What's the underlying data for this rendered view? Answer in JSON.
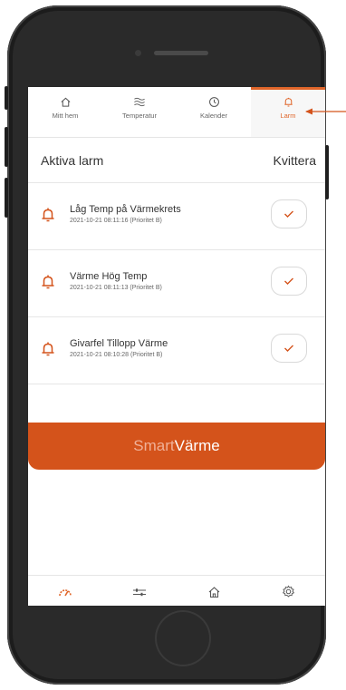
{
  "tabs": [
    {
      "label": "Mitt hem",
      "icon": "home-icon"
    },
    {
      "label": "Temperatur",
      "icon": "heat-waves-icon"
    },
    {
      "label": "Kalender",
      "icon": "clock-icon"
    },
    {
      "label": "Larm",
      "icon": "bell-icon",
      "active": true
    }
  ],
  "alarms_header": {
    "title": "Aktiva larm",
    "acknowledge": "Kvittera"
  },
  "alarms": [
    {
      "name": "Låg Temp på Värmekrets",
      "meta": "2021-10-21 08:11:16 (Prioritet B)"
    },
    {
      "name": "Värme Hög Temp",
      "meta": "2021-10-21 08:11:13 (Prioritet B)"
    },
    {
      "name": "Givarfel Tillopp Värme",
      "meta": "2021-10-21 08:10:28 (Prioritet B)"
    }
  ],
  "brand": {
    "part1": "Smart",
    "part2": "Värme"
  },
  "bottom_nav": [
    {
      "icon": "gauge-icon",
      "active": true
    },
    {
      "icon": "sliders-icon"
    },
    {
      "icon": "home-icon"
    },
    {
      "icon": "gear-icon"
    }
  ],
  "colors": {
    "accent": "#e0662a",
    "banner": "#d4531b",
    "banner_text_light": "#f0b097"
  }
}
